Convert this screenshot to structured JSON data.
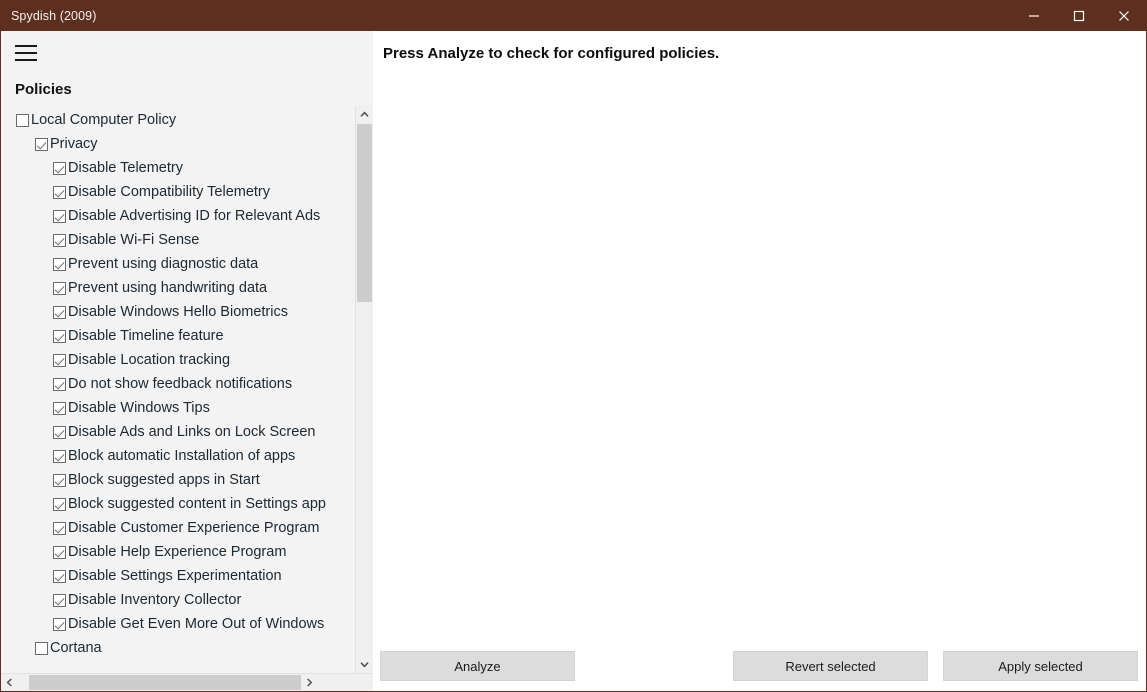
{
  "window": {
    "title": "Spydish (2009)",
    "accent_color": "#5d2f1e",
    "controls": {
      "minimize": "minimize-icon",
      "maximize": "maximize-icon",
      "close": "close-icon"
    }
  },
  "sidebar": {
    "menu_icon": "hamburger-icon",
    "panel_title": "Policies",
    "scroll": {
      "up_arrow": "chevron-up-icon",
      "down_arrow": "chevron-down-icon",
      "left_arrow": "chevron-left-icon",
      "right_arrow": "chevron-right-icon"
    },
    "tree": [
      {
        "label": "Local Computer Policy",
        "level": 0,
        "checked": false
      },
      {
        "label": "Privacy",
        "level": 1,
        "checked": true
      },
      {
        "label": "Disable Telemetry",
        "level": 2,
        "checked": true
      },
      {
        "label": "Disable Compatibility Telemetry",
        "level": 2,
        "checked": true
      },
      {
        "label": "Disable Advertising ID for Relevant Ads",
        "level": 2,
        "checked": true
      },
      {
        "label": "Disable Wi-Fi Sense",
        "level": 2,
        "checked": true
      },
      {
        "label": "Prevent using diagnostic data",
        "level": 2,
        "checked": true
      },
      {
        "label": "Prevent using handwriting data",
        "level": 2,
        "checked": true
      },
      {
        "label": "Disable Windows Hello Biometrics",
        "level": 2,
        "checked": true
      },
      {
        "label": "Disable Timeline feature",
        "level": 2,
        "checked": true
      },
      {
        "label": "Disable Location tracking",
        "level": 2,
        "checked": true
      },
      {
        "label": "Do not show feedback notifications",
        "level": 2,
        "checked": true
      },
      {
        "label": "Disable Windows Tips",
        "level": 2,
        "checked": true
      },
      {
        "label": "Disable Ads and Links on Lock Screen",
        "level": 2,
        "checked": true
      },
      {
        "label": "Block automatic Installation of apps",
        "level": 2,
        "checked": true
      },
      {
        "label": "Block suggested apps in Start",
        "level": 2,
        "checked": true
      },
      {
        "label": "Block suggested content in Settings app",
        "level": 2,
        "checked": true
      },
      {
        "label": "Disable Customer Experience Program",
        "level": 2,
        "checked": true
      },
      {
        "label": "Disable Help Experience Program",
        "level": 2,
        "checked": true
      },
      {
        "label": "Disable Settings Experimentation",
        "level": 2,
        "checked": true
      },
      {
        "label": "Disable Inventory Collector",
        "level": 2,
        "checked": true
      },
      {
        "label": "Disable Get Even More Out of Windows",
        "level": 2,
        "checked": true
      },
      {
        "label": "Cortana",
        "level": 1,
        "checked": false
      }
    ]
  },
  "main": {
    "status_message": "Press Analyze to check for configured policies.",
    "buttons": {
      "analyze": "Analyze",
      "revert": "Revert selected",
      "apply": "Apply selected"
    }
  }
}
